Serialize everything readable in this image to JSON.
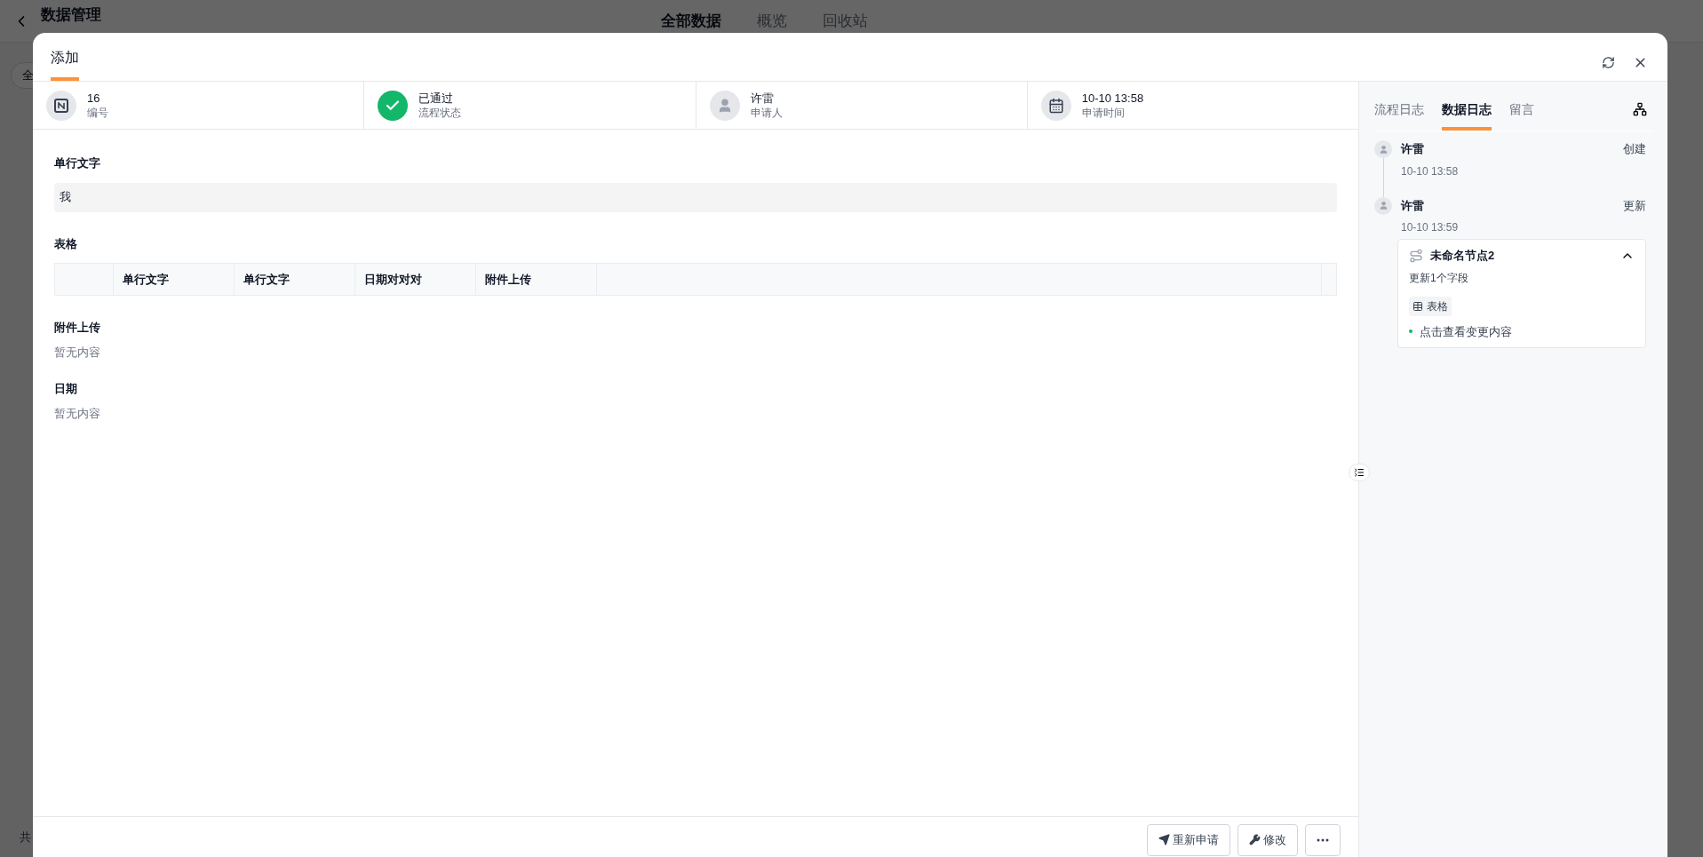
{
  "background": {
    "title": "数据管理",
    "tabs": [
      {
        "label": "全部数据",
        "selected": true
      },
      {
        "label": "概览",
        "selected": false
      },
      {
        "label": "回收站",
        "selected": false
      }
    ],
    "filter_button": "全",
    "footer_text": "共"
  },
  "modal": {
    "tabs": [
      {
        "label": "添加",
        "selected": true
      }
    ],
    "info": [
      {
        "kind": "number",
        "value": "16",
        "label": "编号"
      },
      {
        "kind": "status",
        "value": "已通过",
        "label": "流程状态"
      },
      {
        "kind": "user",
        "value": "许雷",
        "label": "申请人"
      },
      {
        "kind": "date",
        "value": "10-10 13:58",
        "label": "申请时间"
      }
    ],
    "fields": [
      {
        "kind": "text",
        "label": "单行文字",
        "value": "我"
      },
      {
        "kind": "table",
        "label": "表格",
        "columns": [
          "单行文字",
          "单行文字",
          "日期对对对",
          "附件上传"
        ]
      },
      {
        "kind": "empty",
        "label": "附件上传",
        "value": "暂无内容"
      },
      {
        "kind": "empty",
        "label": "日期",
        "value": "暂无内容"
      }
    ],
    "buttons": [
      {
        "kind": "send",
        "label": "重新申请"
      },
      {
        "kind": "wrench",
        "label": "修改"
      },
      {
        "kind": "more"
      }
    ],
    "side": {
      "tabs": [
        {
          "label": "流程日志",
          "selected": false
        },
        {
          "label": "数据日志",
          "selected": true
        },
        {
          "label": "留言",
          "selected": false
        }
      ],
      "logs": [
        {
          "user": "许雷",
          "action": "创建",
          "time": "10-10 13:58"
        },
        {
          "user": "许雷",
          "action": "更新",
          "time": "10-10 13:59",
          "detail": {
            "node": "未命名节点2",
            "expanded": true,
            "summary": "更新1个字段",
            "field": "表格",
            "link": "点击查看变更内容"
          }
        }
      ]
    }
  }
}
